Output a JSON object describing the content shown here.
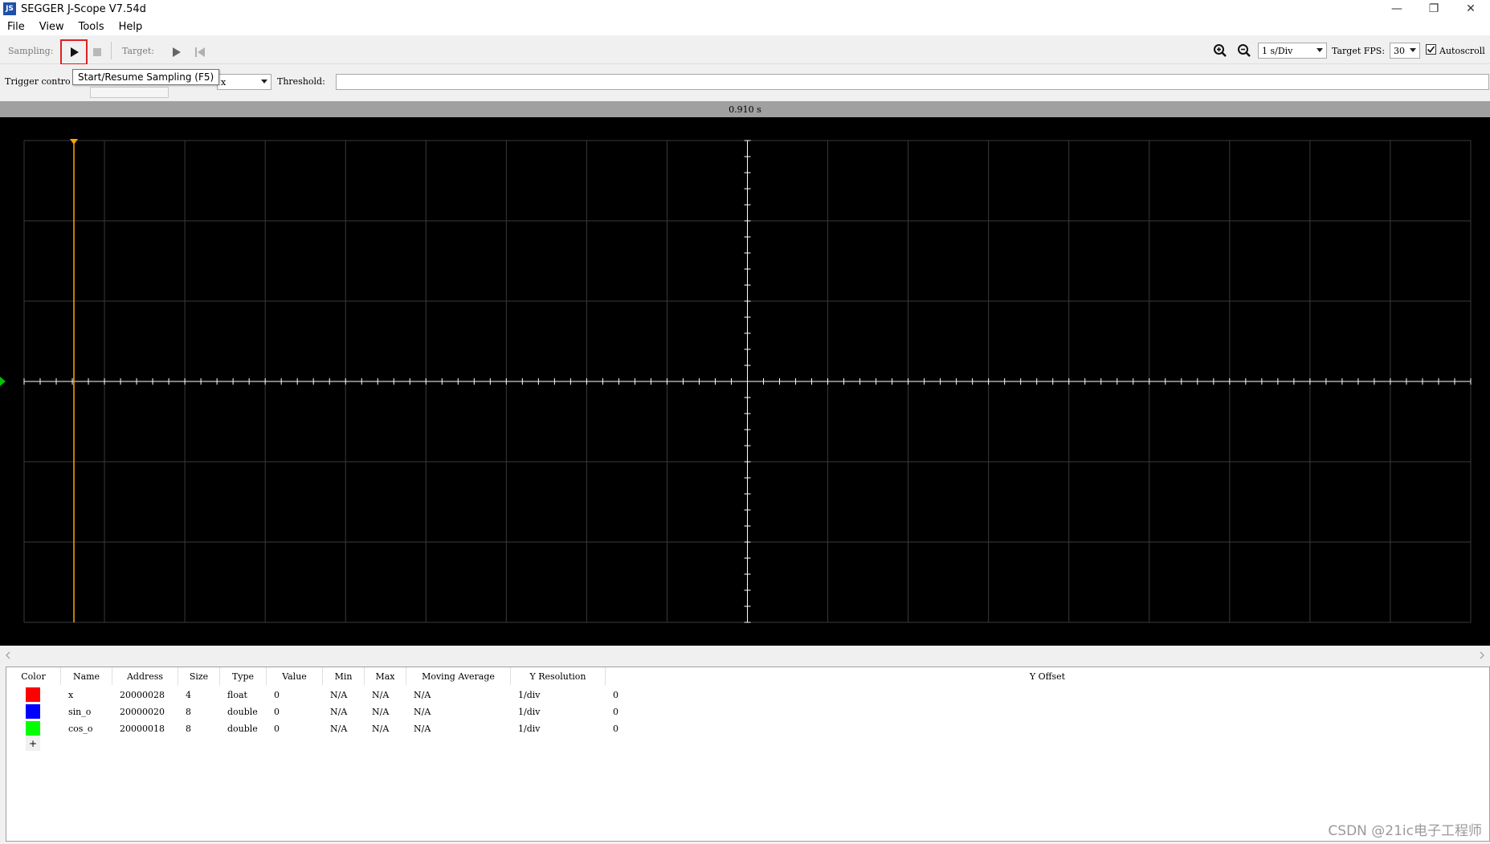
{
  "window": {
    "title": "SEGGER J-Scope V7.54d",
    "icon_text": "JS",
    "minimize": "—",
    "restore": "❐",
    "close": "✕"
  },
  "menu": [
    "File",
    "View",
    "Tools",
    "Help"
  ],
  "toolbar": {
    "sampling_label": "Sampling:",
    "target_label": "Target:",
    "time_per_div": "1 s/Div",
    "fps_label": "Target FPS:",
    "fps_value": "30",
    "autoscroll_label": "Autoscroll",
    "autoscroll_checked": true,
    "icons": [
      "play-icon",
      "stop-icon",
      "target-play-icon",
      "target-reset-icon",
      "zoom-in-icon",
      "zoom-out-icon"
    ]
  },
  "tooltip": "Start/Resume Sampling (F5)",
  "trigger": {
    "label": "Trigger contro",
    "channel": "x",
    "threshold_label": "Threshold:",
    "threshold_value": ""
  },
  "scope": {
    "time_readout": "0.910 s",
    "background": "#000000",
    "grid_color": "#3a3a3a",
    "axis_color": "#ffffff",
    "cursor_color": "#ffa500",
    "level_marker_color": "#00c000"
  },
  "table": {
    "headers": [
      "Color",
      "Name",
      "Address",
      "Size",
      "Type",
      "Value",
      "Min",
      "Max",
      "Moving Average",
      "Y Resolution",
      "Y Offset"
    ],
    "rows": [
      {
        "color": "#ff0000",
        "name": "x",
        "address": "20000028",
        "size": "4",
        "type": "float",
        "value": "0",
        "min": "N/A",
        "max": "N/A",
        "avg": "N/A",
        "yres": "1/div",
        "yoff": "0"
      },
      {
        "color": "#0000ff",
        "name": "sin_o",
        "address": "20000020",
        "size": "8",
        "type": "double",
        "value": "0",
        "min": "N/A",
        "max": "N/A",
        "avg": "N/A",
        "yres": "1/div",
        "yoff": "0"
      },
      {
        "color": "#00ff00",
        "name": "cos_o",
        "address": "20000018",
        "size": "8",
        "type": "double",
        "value": "0",
        "min": "N/A",
        "max": "N/A",
        "avg": "N/A",
        "yres": "1/div",
        "yoff": "0"
      }
    ],
    "add_label": "+"
  },
  "watermark": "CSDN @21ic电子工程师"
}
